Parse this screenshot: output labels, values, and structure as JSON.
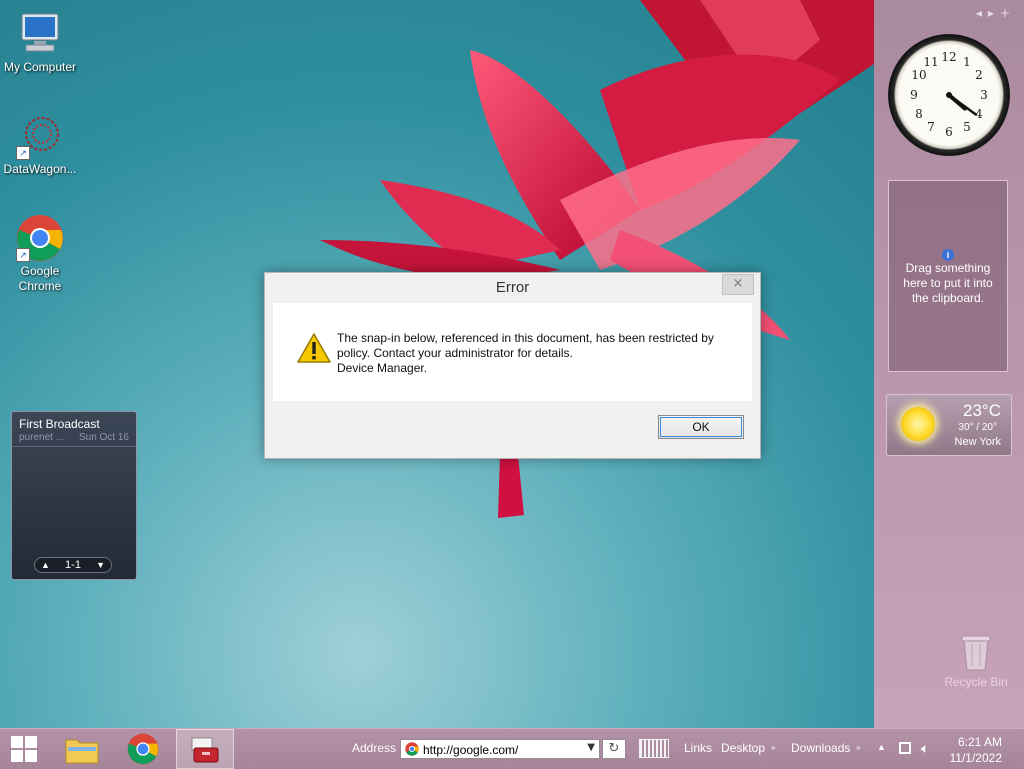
{
  "desktop_icons": [
    {
      "label": "My Computer"
    },
    {
      "label": "DataWagon..."
    },
    {
      "label": "Google Chrome"
    }
  ],
  "broadcast": {
    "title": "First Broadcast",
    "source": "purenet ...",
    "date": "Sun Oct 16",
    "page": "1-1"
  },
  "sidebar": {
    "clipboard": {
      "info_symbol": "i",
      "text": "Drag something here to put it into the clipboard."
    },
    "weather": {
      "temp": "23°C",
      "range": "30° / 20°",
      "city": "New York",
      "condition_icon": "sun-icon"
    },
    "recycle_bin": "Recycle Bin",
    "clock": {
      "hour": 4,
      "minute": 21
    }
  },
  "dialog": {
    "title": "Error",
    "close_symbol": "×",
    "message_line1": "The snap-in below, referenced in this document, has been restricted by",
    "message_line2": "policy. Contact your administrator for details.",
    "message_line3": "Device Manager.",
    "ok_label": "OK"
  },
  "taskbar": {
    "address_label": "Address",
    "address_value": "http://google.com/",
    "links": "Links",
    "desktop": "Desktop",
    "downloads": "Downloads",
    "time": "6:21 AM",
    "date": "11/1/2022"
  },
  "colors": {
    "accent": "#3a8ddd",
    "taskbar": "#a6859a"
  }
}
